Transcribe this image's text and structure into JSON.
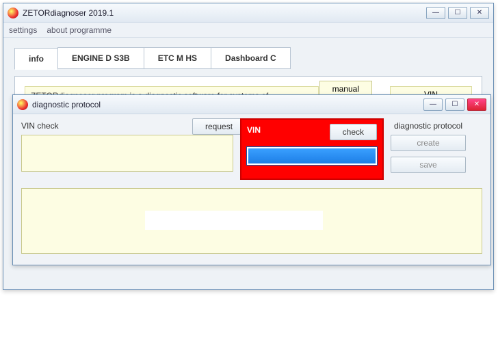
{
  "mainWindow": {
    "title": "ZETORdiagnoser  2019.1",
    "menu": {
      "settings": "settings",
      "about": "about programme"
    },
    "tabs": [
      "info",
      "ENGINE D S3B",
      "ETC M HS",
      "Dashboard C"
    ],
    "activeTab": 0,
    "description": "ZETORdiagnoser program is a diagnostic software for systems of",
    "manualBtn": "manual",
    "sideLabel": "VIN"
  },
  "dialog": {
    "title": "diagnostic protocol",
    "vinCheckLabel": "VIN check",
    "requestBtn": "request",
    "vinLabel": "VIN",
    "checkBtn": "check",
    "vinValue": "",
    "dpHeader": "diagnostic protocol",
    "createBtn": "create",
    "saveBtn": "save"
  },
  "winControls": {
    "min": "—",
    "max": "☐",
    "close": "✕"
  }
}
